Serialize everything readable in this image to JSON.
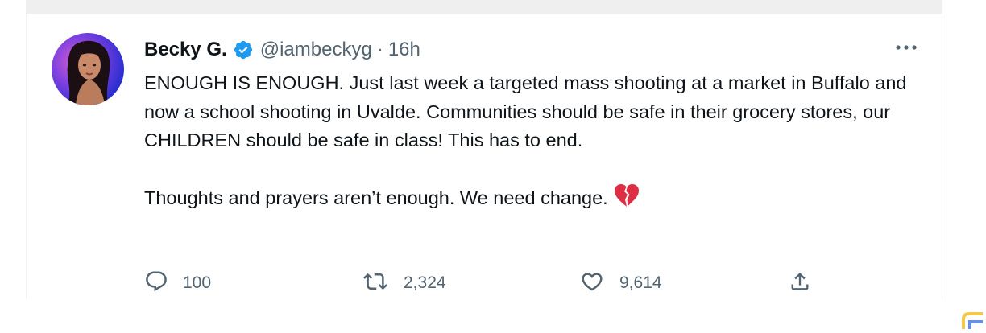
{
  "tweet": {
    "author": {
      "display_name": "Becky G.",
      "handle": "@iambeckyg",
      "verified": true,
      "verified_icon": "verified-badge-icon"
    },
    "separator": "·",
    "timestamp": "16h",
    "more_icon": "more-horizontal-icon",
    "text": {
      "paragraph_1": "ENOUGH IS ENOUGH. Just last week a targeted mass shooting at a market in Buffalo and now a school shooting in Uvalde. Communities should be safe in their grocery stores, our CHILDREN should be safe in class! This has to end.",
      "paragraph_2": "Thoughts and prayers aren’t enough. We need change.",
      "emoji": "broken-heart-icon"
    },
    "actions": {
      "reply": {
        "icon": "reply-icon",
        "count": "100"
      },
      "retweet": {
        "icon": "retweet-icon",
        "count": "2,324"
      },
      "like": {
        "icon": "like-heart-icon",
        "count": "9,614"
      },
      "share": {
        "icon": "share-icon"
      }
    }
  },
  "colors": {
    "text_primary": "#0f1419",
    "text_secondary": "#536471",
    "verified_blue": "#1d9bf0",
    "emoji_red": "#dd2e44",
    "top_strip": "#efefef"
  }
}
